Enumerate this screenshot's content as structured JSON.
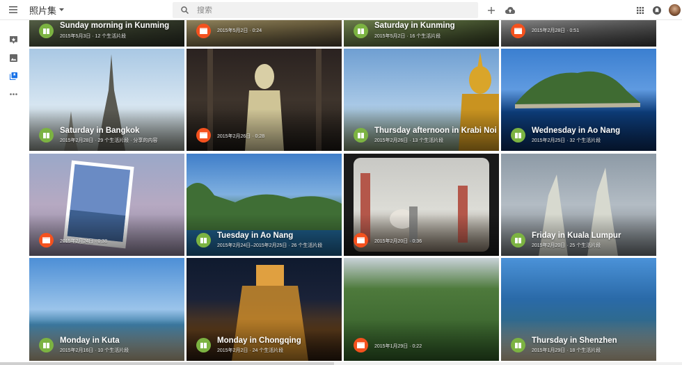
{
  "header": {
    "app_title": "照片集",
    "search_placeholder": "搜索"
  },
  "tiles": [
    {
      "kind": "story",
      "title": "Sunday morning in Kunming",
      "meta": "2015年5月3日 · 12 个生活片段"
    },
    {
      "kind": "movie",
      "title": "",
      "meta": "2015年5月2日 · 0:24"
    },
    {
      "kind": "story",
      "title": "Saturday in Kunming",
      "meta": "2015年5月2日 · 16 个生活片段"
    },
    {
      "kind": "movie",
      "title": "",
      "meta": "2015年2月28日 · 0:51"
    },
    {
      "kind": "story",
      "title": "Saturday in Bangkok",
      "meta": "2015年2月28日 · 29 个生活片段 · 分享的内容"
    },
    {
      "kind": "movie",
      "title": "",
      "meta": "2015年2月26日 · 0:28"
    },
    {
      "kind": "story",
      "title": "Thursday afternoon in Krabi Noi",
      "meta": "2015年2月26日 · 13 个生活片段"
    },
    {
      "kind": "story",
      "title": "Wednesday in Ao Nang",
      "meta": "2015年2月25日 · 32 个生活片段"
    },
    {
      "kind": "movie",
      "title": "",
      "meta": "2015年2月24日 · 0:38"
    },
    {
      "kind": "story",
      "title": "Tuesday in Ao Nang",
      "meta": "2015年2月24日–2015年2月25日 · 26 个生活片段"
    },
    {
      "kind": "movie",
      "title": "",
      "meta": "2015年2月20日 · 0:36"
    },
    {
      "kind": "story",
      "title": "Friday in Kuala Lumpur",
      "meta": "2015年2月20日 · 25 个生活片段"
    },
    {
      "kind": "story",
      "title": "Monday in Kuta",
      "meta": "2015年2月16日 · 10 个生活片段"
    },
    {
      "kind": "story",
      "title": "Monday in Chongqing",
      "meta": "2015年2月2日 · 24 个生活片段"
    },
    {
      "kind": "movie",
      "title": "",
      "meta": "2015年1月29日 · 0:22"
    },
    {
      "kind": "story",
      "title": "Thursday in Shenzhen",
      "meta": "2015年1月29日 · 18 个生活片段"
    }
  ],
  "colors": {
    "story_badge": "#7cb342",
    "movie_badge": "#f4511e"
  }
}
